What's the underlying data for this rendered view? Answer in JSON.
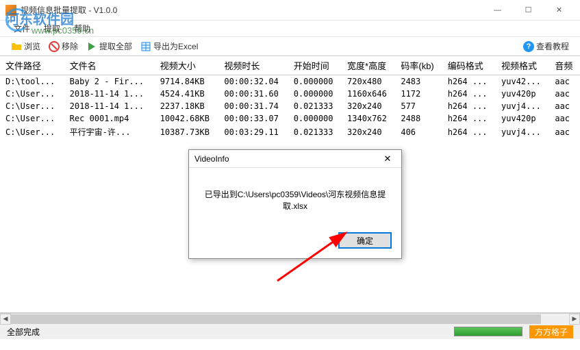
{
  "window": {
    "title": "视频信息批量提取 - V1.0.0",
    "min": "—",
    "max": "☐",
    "close": "✕"
  },
  "watermark": {
    "text": "河东软件园",
    "url": "www.pc0359.cn"
  },
  "menu": {
    "file": "文件",
    "extract": "提取",
    "help": "帮助"
  },
  "toolbar": {
    "browse": "浏览",
    "remove": "移除",
    "extract_all": "提取全部",
    "export_excel": "导出为Excel",
    "tutorial": "查看教程"
  },
  "columns": {
    "path": "文件路径",
    "name": "文件名",
    "size": "视频大小",
    "duration": "视频时长",
    "start": "开始时间",
    "resolution": "宽度*高度",
    "bitrate": "码率(kb)",
    "vcodec": "编码格式",
    "pixfmt": "视频格式",
    "acodec": "音频"
  },
  "rows": [
    {
      "path": "D:\\tool...",
      "name": "Baby 2 - Fir...",
      "size": "9714.84KB",
      "duration": "00:00:32.04",
      "start": "0.000000",
      "resolution": "720x480",
      "bitrate": "2483",
      "vcodec": "h264 ...",
      "pixfmt": "yuv42...",
      "acodec": "aac"
    },
    {
      "path": "C:\\User...",
      "name": "2018-11-14 1...",
      "size": "4524.41KB",
      "duration": "00:00:31.60",
      "start": "0.000000",
      "resolution": "1160x646",
      "bitrate": "1172",
      "vcodec": "h264 ...",
      "pixfmt": "yuv420p",
      "acodec": "aac"
    },
    {
      "path": "C:\\User...",
      "name": "2018-11-14 1...",
      "size": "2237.18KB",
      "duration": "00:00:31.74",
      "start": "0.021333",
      "resolution": "320x240",
      "bitrate": "577",
      "vcodec": "h264 ...",
      "pixfmt": "yuvj4...",
      "acodec": "aac"
    },
    {
      "path": "C:\\User...",
      "name": "Rec 0001.mp4",
      "size": "10042.68KB",
      "duration": "00:00:33.07",
      "start": "0.000000",
      "resolution": "1340x762",
      "bitrate": "2488",
      "vcodec": "h264 ...",
      "pixfmt": "yuv420p",
      "acodec": "aac"
    },
    {
      "path": "C:\\User...",
      "name": "平行宇宙-许...",
      "size": "10387.73KB",
      "duration": "00:03:29.11",
      "start": "0.021333",
      "resolution": "320x240",
      "bitrate": "406",
      "vcodec": "h264 ...",
      "pixfmt": "yuvj4...",
      "acodec": "aac"
    }
  ],
  "dialog": {
    "title": "VideoInfo",
    "message": "已导出到C:\\Users\\pc0359\\Videos\\河东视频信息提取.xlsx",
    "ok": "确定",
    "close": "✕"
  },
  "status": {
    "text": "全部完成",
    "brand": "方方格子"
  },
  "icons": {
    "browse_color": "#ffc107",
    "remove_color": "#e53935",
    "play_color": "#43a047",
    "excel_color": "#1e88e5"
  }
}
